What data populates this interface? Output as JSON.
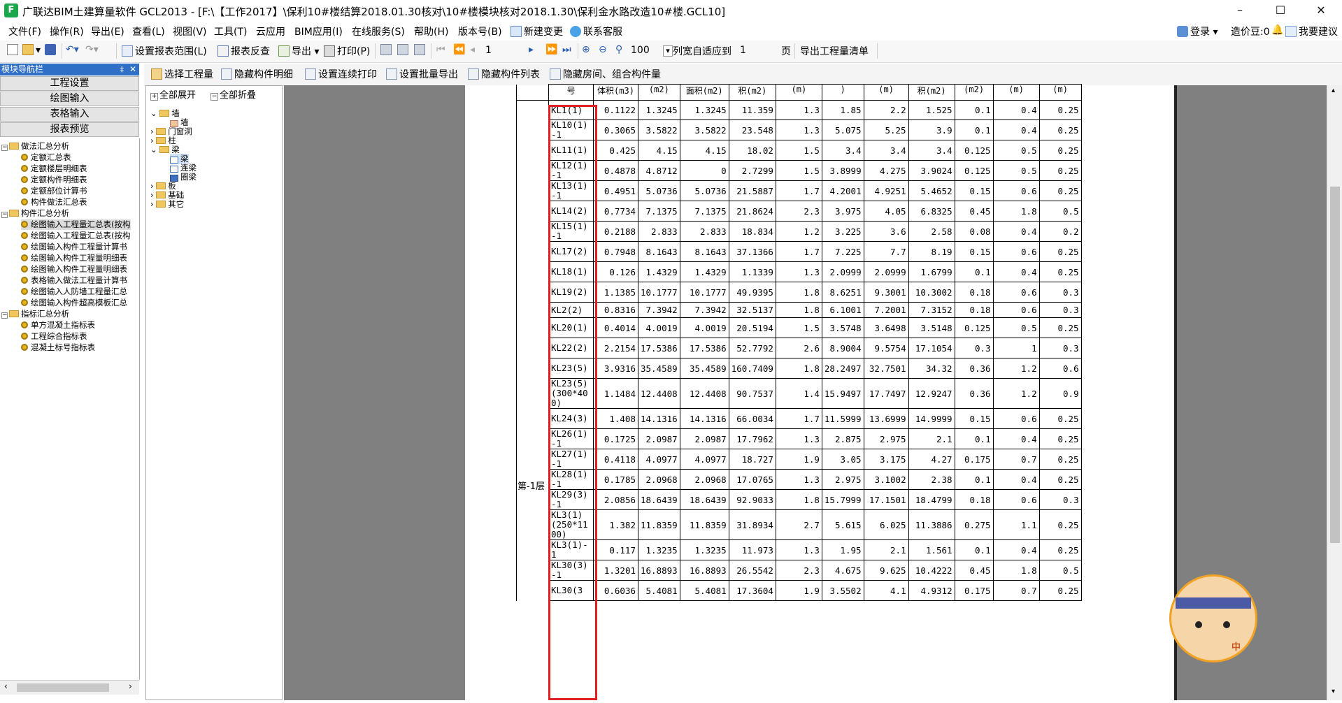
{
  "window": {
    "title": "广联达BIM土建算量软件 GCL2013 - [F:\\【工作2017】\\保利10#楼结算2018.01.30核对\\10#楼模块核对2018.1.30\\保利金水路改造10#楼.GCL10]",
    "icon_letter": "F",
    "minimize": "–",
    "maximize": "☐",
    "close": "✕"
  },
  "menu": {
    "items": [
      "文件(F)",
      "操作(R)",
      "导出(E)",
      "查看(L)",
      "视图(V)",
      "工具(T)",
      "云应用",
      "BIM应用(I)",
      "在线服务(S)",
      "帮助(H)",
      "版本号(B)",
      "新建变更",
      "联系客服"
    ],
    "login": "登录",
    "credit": "造价豆:0",
    "feedback": "我要建议"
  },
  "toolbar1": {
    "set_range": "设置报表范围(L)",
    "reverse_check": "报表反查",
    "export": "导出",
    "print": "打印(P)",
    "page_value": "1",
    "zoom_value": "100",
    "fit_label": "列宽自适应到",
    "fit_value": "1",
    "page_unit": "页",
    "export_list": "导出工程量清单"
  },
  "toolbar2": {
    "select_project": "选择工程量",
    "hide_detail": "隐藏构件明细",
    "continuous_print": "设置连续打印",
    "batch_export": "设置批量导出",
    "hide_list": "隐藏构件列表",
    "hide_room": "隐藏房间、组合构件量"
  },
  "nav": {
    "header": "模块导航栏",
    "pin": "‡",
    "close": "✕",
    "buttons": [
      "工程设置",
      "绘图输入",
      "表格输入",
      "报表预览"
    ],
    "groups": [
      {
        "label": "做法汇总分析",
        "items": [
          "定额汇总表",
          "定额楼层明细表",
          "定额构件明细表",
          "定额部位计算书",
          "构件做法汇总表"
        ]
      },
      {
        "label": "构件汇总分析",
        "items": [
          "绘图输入工程量汇总表(按构",
          "绘图输入工程量汇总表(按构",
          "绘图输入构件工程量计算书",
          "绘图输入构件工程量明细表",
          "绘图输入构件工程量明细表",
          "表格输入做法工程量计算书",
          "绘图输入人防墙工程量汇总",
          "绘图输入构件超高模板汇总"
        ]
      },
      {
        "label": "指标汇总分析",
        "items": [
          "单方混凝土指标表",
          "工程综合指标表",
          "混凝土标号指标表"
        ]
      }
    ]
  },
  "comp_tree": {
    "expand_all": "全部展开",
    "collapse_all": "全部折叠",
    "nodes": {
      "wall": "墙",
      "wall_child": "墙",
      "door": "门窗洞",
      "column": "柱",
      "beam": "梁",
      "beam_child": "梁",
      "link_beam": "连梁",
      "ring_beam": "圈梁",
      "slab": "板",
      "foundation": "基础",
      "other": "其它"
    }
  },
  "report": {
    "floor": "第-1层",
    "headers": [
      "号",
      "体积(m3)",
      "(m2)",
      "面积(m2)",
      "积(m2)",
      "(m)",
      ")",
      "(m)",
      "积(m2)",
      "(m2)",
      "(m)",
      "(m)"
    ],
    "rows": [
      {
        "name": "KL1(1)",
        "v": [
          "0.1122",
          "1.3245",
          "1.3245",
          "11.359",
          "1.3",
          "1.85",
          "2.2",
          "1.525",
          "0.1",
          "0.4",
          "0.25"
        ]
      },
      {
        "name": "KL10(1)-1",
        "v": [
          "0.3065",
          "3.5822",
          "3.5822",
          "23.548",
          "1.3",
          "5.075",
          "5.25",
          "3.9",
          "0.1",
          "0.4",
          "0.25"
        ]
      },
      {
        "name": "KL11(1)",
        "v": [
          "0.425",
          "4.15",
          "4.15",
          "18.02",
          "1.5",
          "3.4",
          "3.4",
          "3.4",
          "0.125",
          "0.5",
          "0.25"
        ]
      },
      {
        "name": "KL12(1)-1",
        "v": [
          "0.4878",
          "4.8712",
          "0",
          "2.7299",
          "1.5",
          "3.8999",
          "4.275",
          "3.9024",
          "0.125",
          "0.5",
          "0.25"
        ]
      },
      {
        "name": "KL13(1)-1",
        "v": [
          "0.4951",
          "5.0736",
          "5.0736",
          "21.5887",
          "1.7",
          "4.2001",
          "4.9251",
          "5.4652",
          "0.15",
          "0.6",
          "0.25"
        ]
      },
      {
        "name": "KL14(2)",
        "v": [
          "0.7734",
          "7.1375",
          "7.1375",
          "21.8624",
          "2.3",
          "3.975",
          "4.05",
          "6.8325",
          "0.45",
          "1.8",
          "0.5"
        ]
      },
      {
        "name": "KL15(1)-1",
        "v": [
          "0.2188",
          "2.833",
          "2.833",
          "18.834",
          "1.2",
          "3.225",
          "3.6",
          "2.58",
          "0.08",
          "0.4",
          "0.2"
        ]
      },
      {
        "name": "KL17(2)",
        "v": [
          "0.7948",
          "8.1643",
          "8.1643",
          "37.1366",
          "1.7",
          "7.225",
          "7.7",
          "8.19",
          "0.15",
          "0.6",
          "0.25"
        ]
      },
      {
        "name": "KL18(1)",
        "v": [
          "0.126",
          "1.4329",
          "1.4329",
          "1.1339",
          "1.3",
          "2.0999",
          "2.0999",
          "1.6799",
          "0.1",
          "0.4",
          "0.25"
        ]
      },
      {
        "name": "KL19(2)",
        "v": [
          "1.1385",
          "10.1777",
          "10.1777",
          "49.9395",
          "1.8",
          "8.6251",
          "9.3001",
          "10.3002",
          "0.18",
          "0.6",
          "0.3"
        ]
      },
      {
        "name": "KL2(2)",
        "v": [
          "0.8316",
          "7.3942",
          "7.3942",
          "32.5137",
          "1.8",
          "6.1001",
          "7.2001",
          "7.3152",
          "0.18",
          "0.6",
          "0.3"
        ]
      },
      {
        "name": "KL20(1)",
        "v": [
          "0.4014",
          "4.0019",
          "4.0019",
          "20.5194",
          "1.5",
          "3.5748",
          "3.6498",
          "3.5148",
          "0.125",
          "0.5",
          "0.25"
        ]
      },
      {
        "name": "KL22(2)",
        "v": [
          "2.2154",
          "17.5386",
          "17.5386",
          "52.7792",
          "2.6",
          "8.9004",
          "9.5754",
          "17.1054",
          "0.3",
          "1",
          "0.3"
        ]
      },
      {
        "name": "KL23(5)",
        "v": [
          "3.9316",
          "35.4589",
          "35.4589",
          "160.7409",
          "1.8",
          "28.2497",
          "32.7501",
          "34.32",
          "0.36",
          "1.2",
          "0.6"
        ]
      },
      {
        "name": "KL23(5)(300*400)",
        "v": [
          "1.1484",
          "12.4408",
          "12.4408",
          "90.7537",
          "1.4",
          "15.9497",
          "17.7497",
          "12.9247",
          "0.36",
          "1.2",
          "0.9"
        ]
      },
      {
        "name": "KL24(3)",
        "v": [
          "1.408",
          "14.1316",
          "14.1316",
          "66.0034",
          "1.7",
          "11.5999",
          "13.6999",
          "14.9999",
          "0.15",
          "0.6",
          "0.25"
        ]
      },
      {
        "name": "KL26(1)-1",
        "v": [
          "0.1725",
          "2.0987",
          "2.0987",
          "17.7962",
          "1.3",
          "2.875",
          "2.975",
          "2.1",
          "0.1",
          "0.4",
          "0.25"
        ]
      },
      {
        "name": "KL27(1)-1",
        "v": [
          "0.4118",
          "4.0977",
          "4.0977",
          "18.727",
          "1.9",
          "3.05",
          "3.175",
          "4.27",
          "0.175",
          "0.7",
          "0.25"
        ]
      },
      {
        "name": "KL28(1)-1",
        "v": [
          "0.1785",
          "2.0968",
          "2.0968",
          "17.0765",
          "1.3",
          "2.975",
          "3.1002",
          "2.38",
          "0.1",
          "0.4",
          "0.25"
        ]
      },
      {
        "name": "KL29(3)-1",
        "v": [
          "2.0856",
          "18.6439",
          "18.6439",
          "92.9033",
          "1.8",
          "15.7999",
          "17.1501",
          "18.4799",
          "0.18",
          "0.6",
          "0.3"
        ]
      },
      {
        "name": "KL3(1)(250*1100)",
        "v": [
          "1.382",
          "11.8359",
          "11.8359",
          "31.8934",
          "2.7",
          "5.615",
          "6.025",
          "11.3886",
          "0.275",
          "1.1",
          "0.25"
        ]
      },
      {
        "name": "KL3(1)-1",
        "v": [
          "0.117",
          "1.3235",
          "1.3235",
          "11.973",
          "1.3",
          "1.95",
          "2.1",
          "1.561",
          "0.1",
          "0.4",
          "0.25"
        ]
      },
      {
        "name": "KL30(3)-1",
        "v": [
          "1.3201",
          "16.8893",
          "16.8893",
          "26.5542",
          "2.3",
          "4.675",
          "9.625",
          "10.4222",
          "0.45",
          "1.8",
          "0.5"
        ]
      },
      {
        "name": "KL30(3",
        "v": [
          "0.6036",
          "5.4081",
          "5.4081",
          "17.3604",
          "1.9",
          "3.5502",
          "4.1",
          "4.9312",
          "0.175",
          "0.7",
          "0.25"
        ]
      }
    ]
  },
  "mascot": {
    "badge": "中"
  },
  "colors": {
    "nav_header": "#2f6fc5",
    "highlight": "#e02020",
    "report_bg": "#808080"
  }
}
